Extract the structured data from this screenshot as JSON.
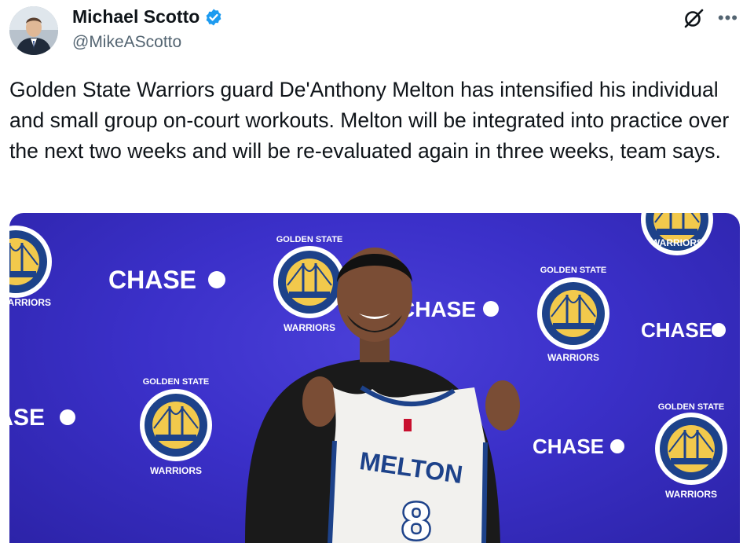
{
  "author": {
    "name": "Michael Scotto",
    "handle": "@MikeAScotto",
    "verified": true
  },
  "icons": {
    "verified": "verified-badge-icon",
    "grok": "grok-icon",
    "more": "more-icon"
  },
  "colors": {
    "verified": "#1d9bf0",
    "backdrop": "#3b30c9",
    "logo_gold": "#f2c94c",
    "logo_navy": "#1d428a"
  },
  "tweet": {
    "text": "Golden State Warriors guard De'Anthony Melton has intensified his individual and small group on-court workouts. Melton will be integrated into practice over the next two weeks and will be re-evaluated again in three weeks, team says."
  },
  "media": {
    "sponsor": "CHASE",
    "logo_top": "GOLDEN STATE",
    "logo_bottom": "WARRIORS",
    "jersey_name": "MELTON",
    "jersey_number": "8"
  }
}
